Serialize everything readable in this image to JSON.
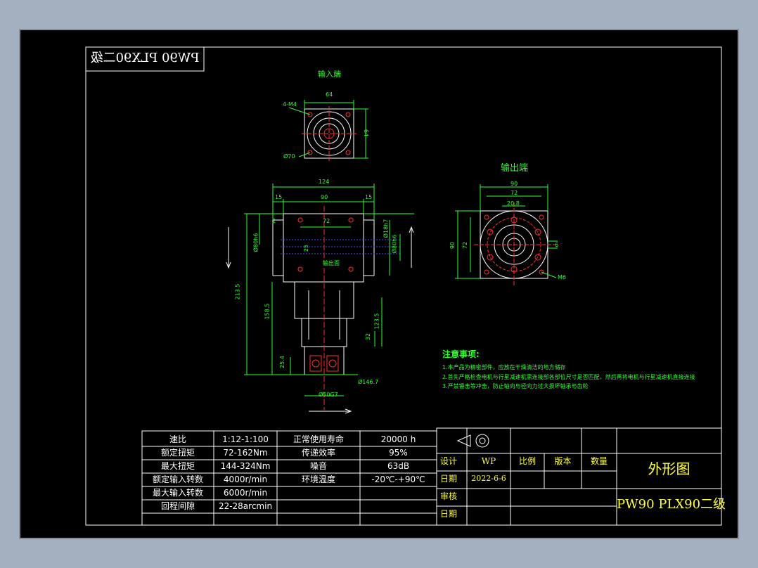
{
  "corner_title": "PW90 PLX90二级",
  "views": {
    "input_end_label": "输入端",
    "output_end_label": "输出端",
    "input_dims": {
      "width": "64",
      "height": "64",
      "hole": "4-M4",
      "pcd": "Ø70"
    },
    "front_dims": {
      "overall": "124",
      "center": "90",
      "left_margin": "15",
      "right_margin": "15",
      "bolt_span": "72",
      "small": "2",
      "shaft": "Ø18h7",
      "pilot": "Ø80h6",
      "key": "25",
      "pilot2": "Ø80h6",
      "mount_face": "输出面",
      "total_h": "213.5",
      "body_h": "158.5",
      "motor_h": "123.5",
      "flange": "32",
      "bottom": "25.4",
      "motor_pilot": "Ø50G7",
      "motor_pcd": "Ø146.7"
    },
    "output_dims": {
      "overall": "90",
      "pcd": "72",
      "key_w": "20.8",
      "height": "90",
      "height2": "72",
      "key": "6",
      "thread": "M6"
    }
  },
  "notes": {
    "title": "注意事项:",
    "items": [
      "1.本产品为精密部件，应放在干燥清洁的地方储存",
      "2.首先严格检查电机与行星减速机需连接部各部位尺寸是否匹配，然后再将电机与行星减速机直接连接",
      "3.严禁锤击等冲击，防止轴向与径向力过大损坏轴承与齿轮"
    ]
  },
  "spec_table": {
    "rows": [
      {
        "k1": "速比",
        "v1": "1:12-1:100",
        "k2": "正常使用寿命",
        "v2": "20000 h"
      },
      {
        "k1": "额定扭矩",
        "v1": "72-162Nm",
        "k2": "传递效率",
        "v2": "95%"
      },
      {
        "k1": "最大扭矩",
        "v1": "144-324Nm",
        "k2": "噪音",
        "v2": "63dB"
      },
      {
        "k1": "额定输入转数",
        "v1": "4000r/min",
        "k2": "环境温度",
        "v2": "-20℃-+90℃"
      },
      {
        "k1": "最大输入转数",
        "v1": "6000r/min",
        "k2": "",
        "v2": ""
      },
      {
        "k1": "回程间隙",
        "v1": "22-28arcmin",
        "k2": "",
        "v2": ""
      }
    ]
  },
  "title_block": {
    "design_label": "设计",
    "design_value": "WP",
    "scale_label": "比例",
    "version_label": "版本",
    "qty_label": "数量",
    "date_label": "日期",
    "date_value": "2022-6-6",
    "review_label": "审核",
    "date2_label": "日期",
    "drawing_name": "外形图",
    "model": "PW90 PLX90二级"
  },
  "colors": {
    "background": "#000000",
    "line": "#ffffff",
    "dimension": "#30ff30",
    "text": "#ffff40",
    "hole": "#ff3030",
    "center": "#ff3030",
    "hatch": "#4040ff"
  }
}
